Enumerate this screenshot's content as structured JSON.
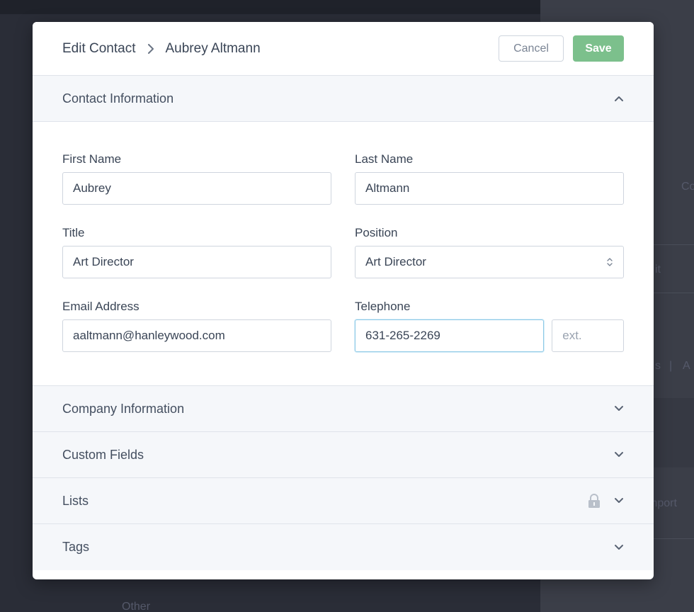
{
  "background": {
    "fragments": [
      "Co",
      "it",
      "s",
      "A",
      "mport",
      "Other"
    ]
  },
  "modal": {
    "breadcrumb": {
      "parent": "Edit Contact",
      "current": "Aubrey Altmann"
    },
    "actions": {
      "cancel_label": "Cancel",
      "save_label": "Save"
    },
    "sections": {
      "contact_information": "Contact Information",
      "company_information": "Company Information",
      "custom_fields": "Custom Fields",
      "lists": "Lists",
      "tags": "Tags"
    },
    "form": {
      "first_name": {
        "label": "First Name",
        "value": "Aubrey"
      },
      "last_name": {
        "label": "Last Name",
        "value": "Altmann"
      },
      "title": {
        "label": "Title",
        "value": "Art Director"
      },
      "position": {
        "label": "Position",
        "value": "Art Director"
      },
      "email": {
        "label": "Email Address",
        "value": "aaltmann@hanleywood.com"
      },
      "telephone": {
        "label": "Telephone",
        "value": "631-265-2269",
        "ext_placeholder": "ext."
      }
    }
  },
  "colors": {
    "accent_save": "#7cc08c",
    "focus_border": "#8ec9e6",
    "section_bg": "#f5f7fa"
  }
}
